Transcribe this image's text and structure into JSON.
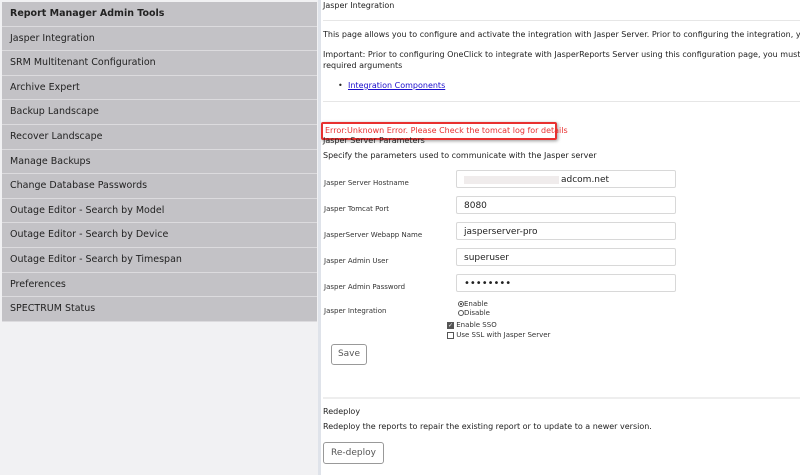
{
  "sidebar": {
    "title": "Report Manager Admin Tools",
    "items": [
      {
        "label": "Jasper Integration"
      },
      {
        "label": "SRM Multitenant Configuration"
      },
      {
        "label": "Archive Expert"
      },
      {
        "label": "Backup Landscape"
      },
      {
        "label": "Recover Landscape"
      },
      {
        "label": "Manage Backups"
      },
      {
        "label": "Change Database Passwords"
      },
      {
        "label": "Outage Editor - Search by Model"
      },
      {
        "label": "Outage Editor - Search by Device"
      },
      {
        "label": "Outage Editor - Search by Timespan"
      },
      {
        "label": "Preferences"
      },
      {
        "label": "SPECTRUM Status"
      }
    ]
  },
  "main": {
    "title": "Jasper Integration",
    "intro": "This page allows you to configure and activate the integration with Jasper Server. Prior to configuring the integration, you mus",
    "important_line1": "Important: Prior to configuring OneClick to integrate with JasperReports Server using this configuration page, you must downlo",
    "important_line2": "required arguments",
    "link": "Integration Components",
    "error": "Error:Unknown Error. Please Check the tomcat log for details",
    "params_heading": "Jasper Server Parameters",
    "params_desc": "Specify the parameters used to communicate with the Jasper server",
    "fields": {
      "hostname": {
        "label": "Jasper Server Hostname",
        "value": "adcom.net"
      },
      "port": {
        "label": "Jasper Tomcat Port",
        "value": "8080"
      },
      "webapp": {
        "label": "JasperServer Webapp Name",
        "value": "jasperserver-pro"
      },
      "user": {
        "label": "Jasper Admin User",
        "value": "superuser"
      },
      "password": {
        "label": "Jasper Admin Password",
        "value": "••••••••"
      }
    },
    "integration": {
      "label": "Jasper Integration",
      "enable": "Enable",
      "disable": "Disable",
      "selected": "Enable"
    },
    "enable_sso": {
      "label": "Enable SSO",
      "checked": true
    },
    "use_ssl": {
      "label": "Use SSL with Jasper Server",
      "checked": false
    },
    "save_label": "Save",
    "redeploy": {
      "heading": "Redeploy",
      "desc": "Redeploy the reports to repair the existing report or to update to a newer version.",
      "button": "Re-deploy"
    }
  }
}
